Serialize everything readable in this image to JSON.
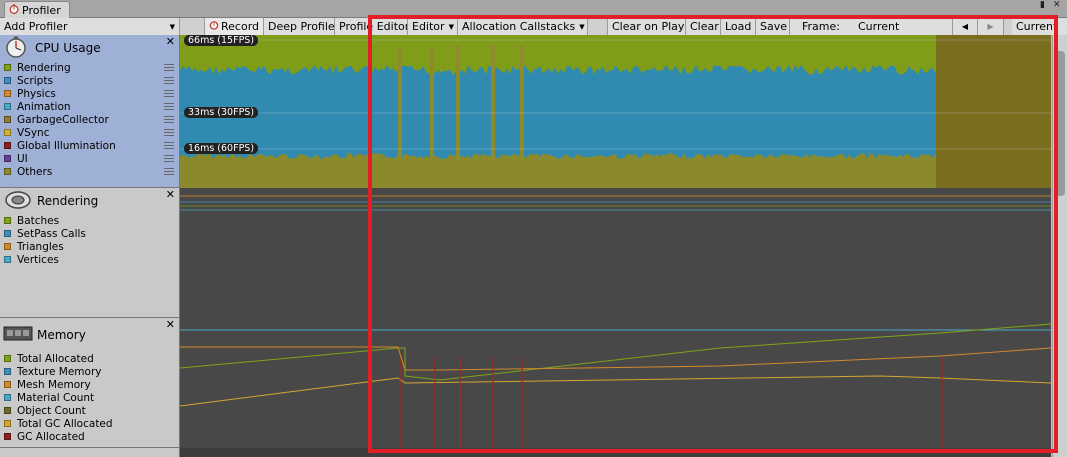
{
  "window": {
    "tab_title": "Profiler"
  },
  "toolbar": {
    "add_profiler": "Add Profiler",
    "record": "Record",
    "deep_profile": "Deep Profile",
    "profile_editor": "Profile Editor",
    "editor_target": "Editor",
    "allocation_callstacks": "Allocation Callstacks",
    "clear_on_play": "Clear on Play",
    "clear": "Clear",
    "load": "Load",
    "save": "Save",
    "frame_label": "Frame:",
    "frame_value": "Current",
    "current": "Current"
  },
  "cpu": {
    "title": "CPU Usage",
    "labels": [
      "66ms (15FPS)",
      "33ms (30FPS)",
      "16ms (60FPS)"
    ],
    "legend": [
      {
        "label": "Rendering",
        "color": "#7fa515"
      },
      {
        "label": "Scripts",
        "color": "#3e8fc0"
      },
      {
        "label": "Physics",
        "color": "#d38a2b"
      },
      {
        "label": "Animation",
        "color": "#4aa9c9"
      },
      {
        "label": "GarbageCollector",
        "color": "#8f7a36"
      },
      {
        "label": "VSync",
        "color": "#d4b434"
      },
      {
        "label": "Global Illumination",
        "color": "#8c1f1f"
      },
      {
        "label": "UI",
        "color": "#6a3c9a"
      },
      {
        "label": "Others",
        "color": "#8d8a2b"
      }
    ]
  },
  "rendering": {
    "title": "Rendering",
    "legend": [
      {
        "label": "Batches",
        "color": "#7fa515"
      },
      {
        "label": "SetPass Calls",
        "color": "#3e8fc0"
      },
      {
        "label": "Triangles",
        "color": "#d38a2b"
      },
      {
        "label": "Vertices",
        "color": "#4aa9c9"
      }
    ]
  },
  "memory": {
    "title": "Memory",
    "legend": [
      {
        "label": "Total Allocated",
        "color": "#7fa515"
      },
      {
        "label": "Texture Memory",
        "color": "#3e8fc0"
      },
      {
        "label": "Mesh Memory",
        "color": "#d38a2b"
      },
      {
        "label": "Material Count",
        "color": "#4aa9c9"
      },
      {
        "label": "Object Count",
        "color": "#6f6a2a"
      },
      {
        "label": "Total GC Allocated",
        "color": "#d4a72e"
      },
      {
        "label": "GC Allocated",
        "color": "#8c1f1f"
      }
    ]
  },
  "icons": {
    "profiler_tab": "stopwatch-icon",
    "record": "record-icon",
    "cpu": "stopwatch-icon",
    "rendering": "rendering-icon",
    "memory": "memory-chip-icon",
    "close": "close-icon",
    "prev_frame": "arrow-left-icon",
    "next_frame": "arrow-right-icon"
  }
}
